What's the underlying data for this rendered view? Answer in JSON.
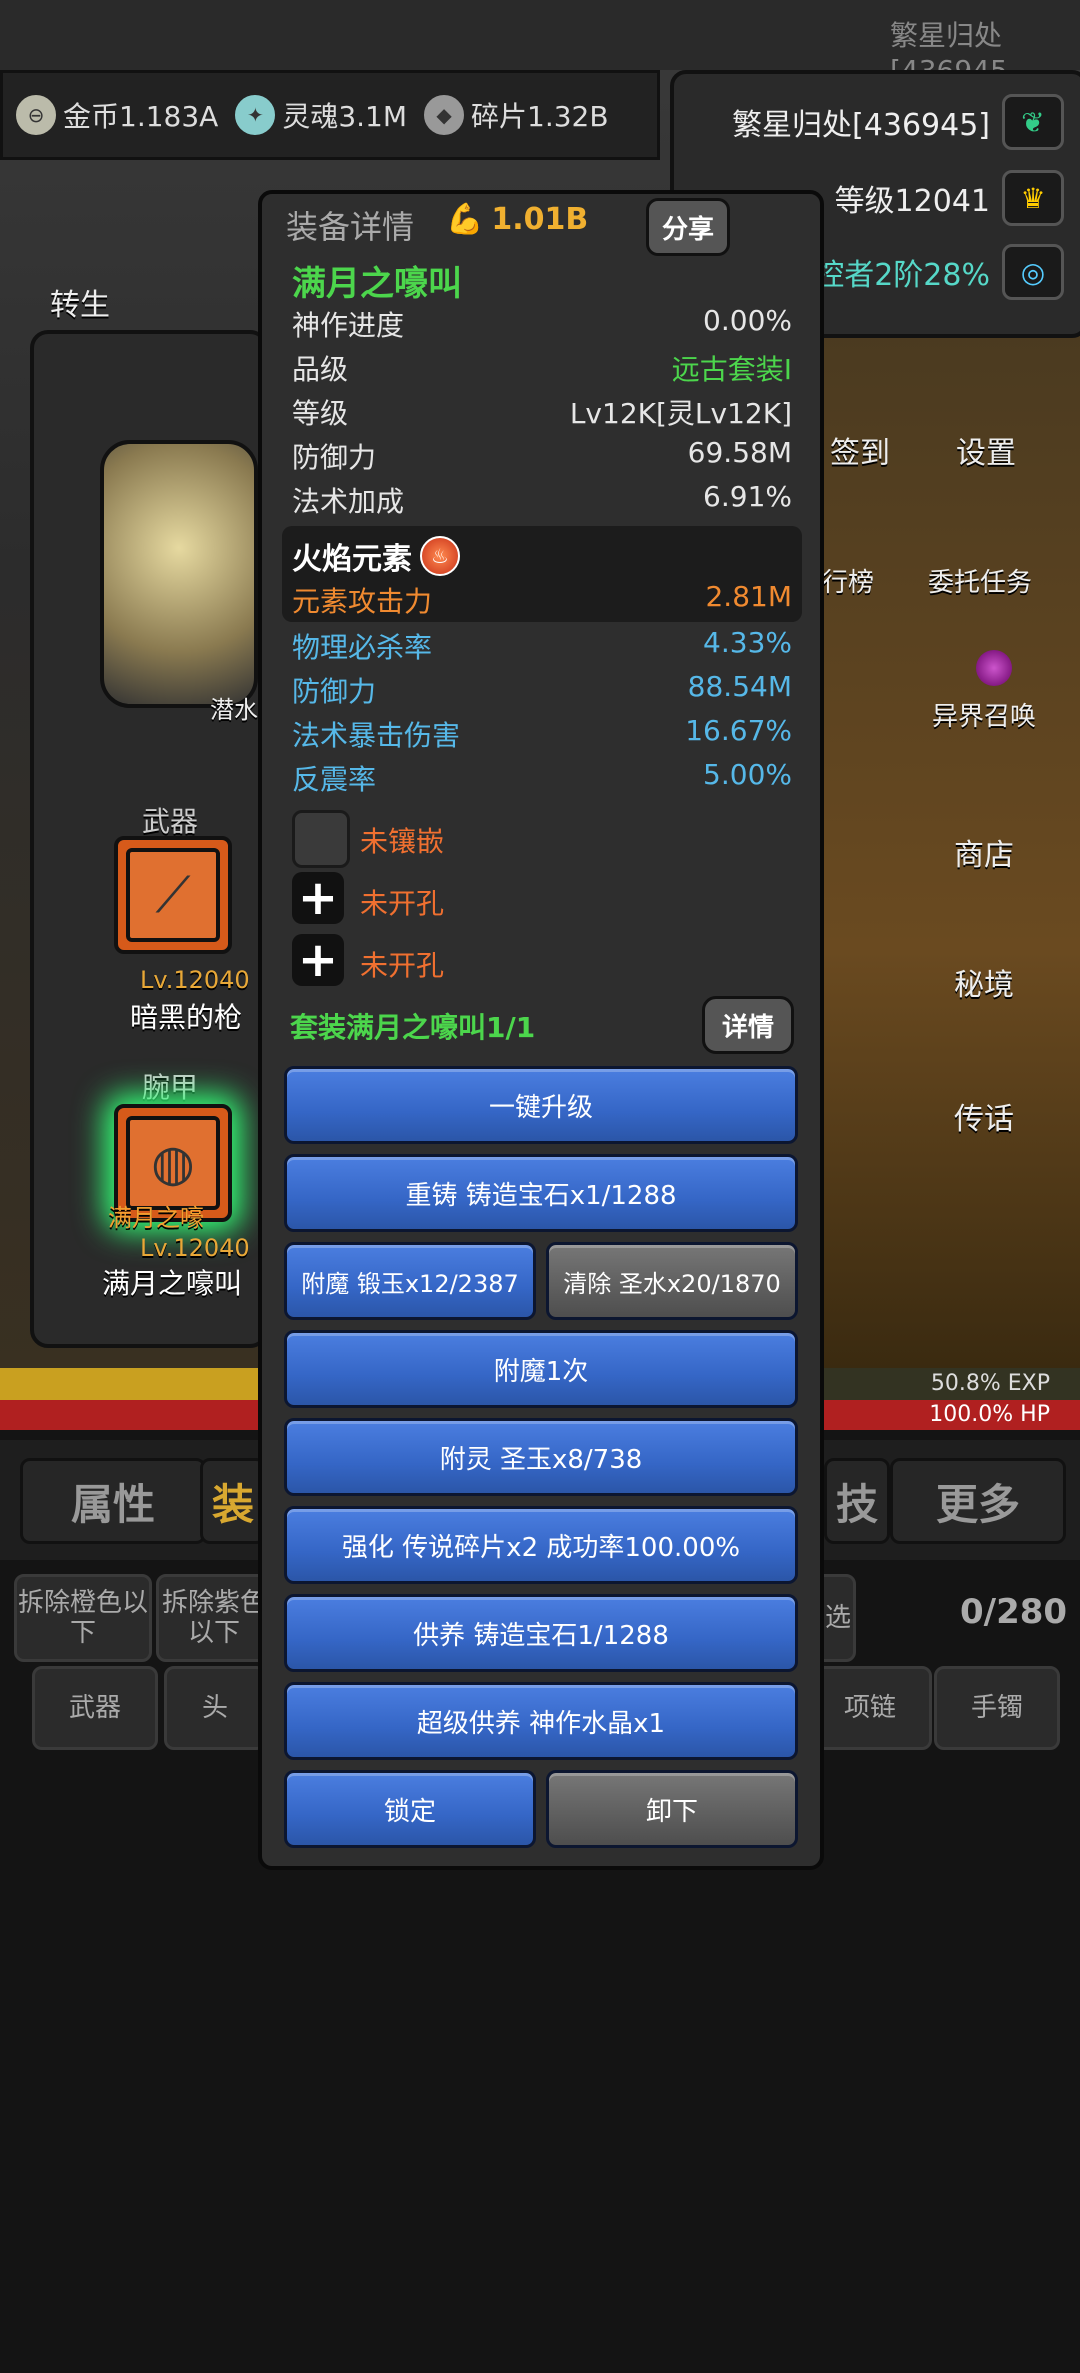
{
  "top": {
    "server": "繁星归处[436945",
    "resources": [
      {
        "icon": "coin-icon",
        "label": "金币1.183A"
      },
      {
        "icon": "soul-icon",
        "label": "灵魂3.1M"
      },
      {
        "icon": "fragment-icon",
        "label": "碎片1.32B"
      }
    ]
  },
  "player": {
    "server": "繁星归处[436945]",
    "level": "等级12041",
    "rank": "控者2阶28%"
  },
  "left": {
    "rebirth": "转生",
    "hidden": "潜水",
    "weapon_label": "武器",
    "weapon_level": "Lv.12040",
    "weapon_name": "暗黑的枪",
    "armor_label": "腕甲",
    "armor_tag": "满月之嚎",
    "armor_level": "Lv.12040",
    "armor_name": "满月之嚎叫"
  },
  "right": {
    "sign_in": "签到",
    "settings": "设置",
    "rank": "行榜",
    "entrust": "委托任务",
    "summon": "异界召唤",
    "shop": "商店",
    "secret": "秘境",
    "legend": "传话"
  },
  "bars": {
    "exp": "50.8% EXP",
    "hp": "100.0% HP"
  },
  "tabs": [
    "属性",
    "装",
    "技",
    "更多"
  ],
  "filters": {
    "dismantle_orange": "拆除橙色以下",
    "dismantle_purple": "拆除紫色以下",
    "filter": "选",
    "count": "0/280",
    "slots": [
      "武器",
      "头",
      "项链",
      "手镯"
    ]
  },
  "dialog": {
    "title": "装备详情",
    "power": "1.01B",
    "share": "分享",
    "item_name": "满月之嚎叫",
    "stats": [
      {
        "label": "神作进度",
        "value": "0.00%"
      },
      {
        "label": "品级",
        "value": "远古套装I"
      },
      {
        "label": "等级",
        "value": "Lv12K[灵Lv12K]"
      },
      {
        "label": "防御力",
        "value": "69.58M"
      },
      {
        "label": "法术加成",
        "value": "6.91%"
      }
    ],
    "element_title": "火焰元素",
    "element_stats": [
      {
        "label": "元素攻击力",
        "value": "2.81M"
      },
      {
        "label": "物理必杀率",
        "value": "4.33%"
      },
      {
        "label": "防御力",
        "value": "88.54M"
      },
      {
        "label": "法术暴击伤害",
        "value": "16.67%"
      },
      {
        "label": "反震率",
        "value": "5.00%"
      }
    ],
    "sockets": [
      "未镶嵌",
      "未开孔",
      "未开孔"
    ],
    "set_title": "套装满月之嚎叫1/1",
    "detail": "详情",
    "actions": {
      "upgrade_all": "一键升级",
      "recast": "重铸 铸造宝石x1/1288",
      "enchant": "附魔 锻玉x12/2387",
      "clear": "清除 圣水x20/1870",
      "enchant_once": "附魔1次",
      "spirit": "附灵 圣玉x8/738",
      "strengthen": "强化 传说碎片x2 成功率100.00%",
      "nurture": "供养 铸造宝石1/1288",
      "super_nurture": "超级供养 神作水晶x1",
      "lock": "锁定",
      "unequip": "卸下"
    }
  },
  "colors": {
    "green": "#4cd64c",
    "blue": "#56b8e8",
    "orange": "#f08a30",
    "button_blue": "#3566c6"
  }
}
